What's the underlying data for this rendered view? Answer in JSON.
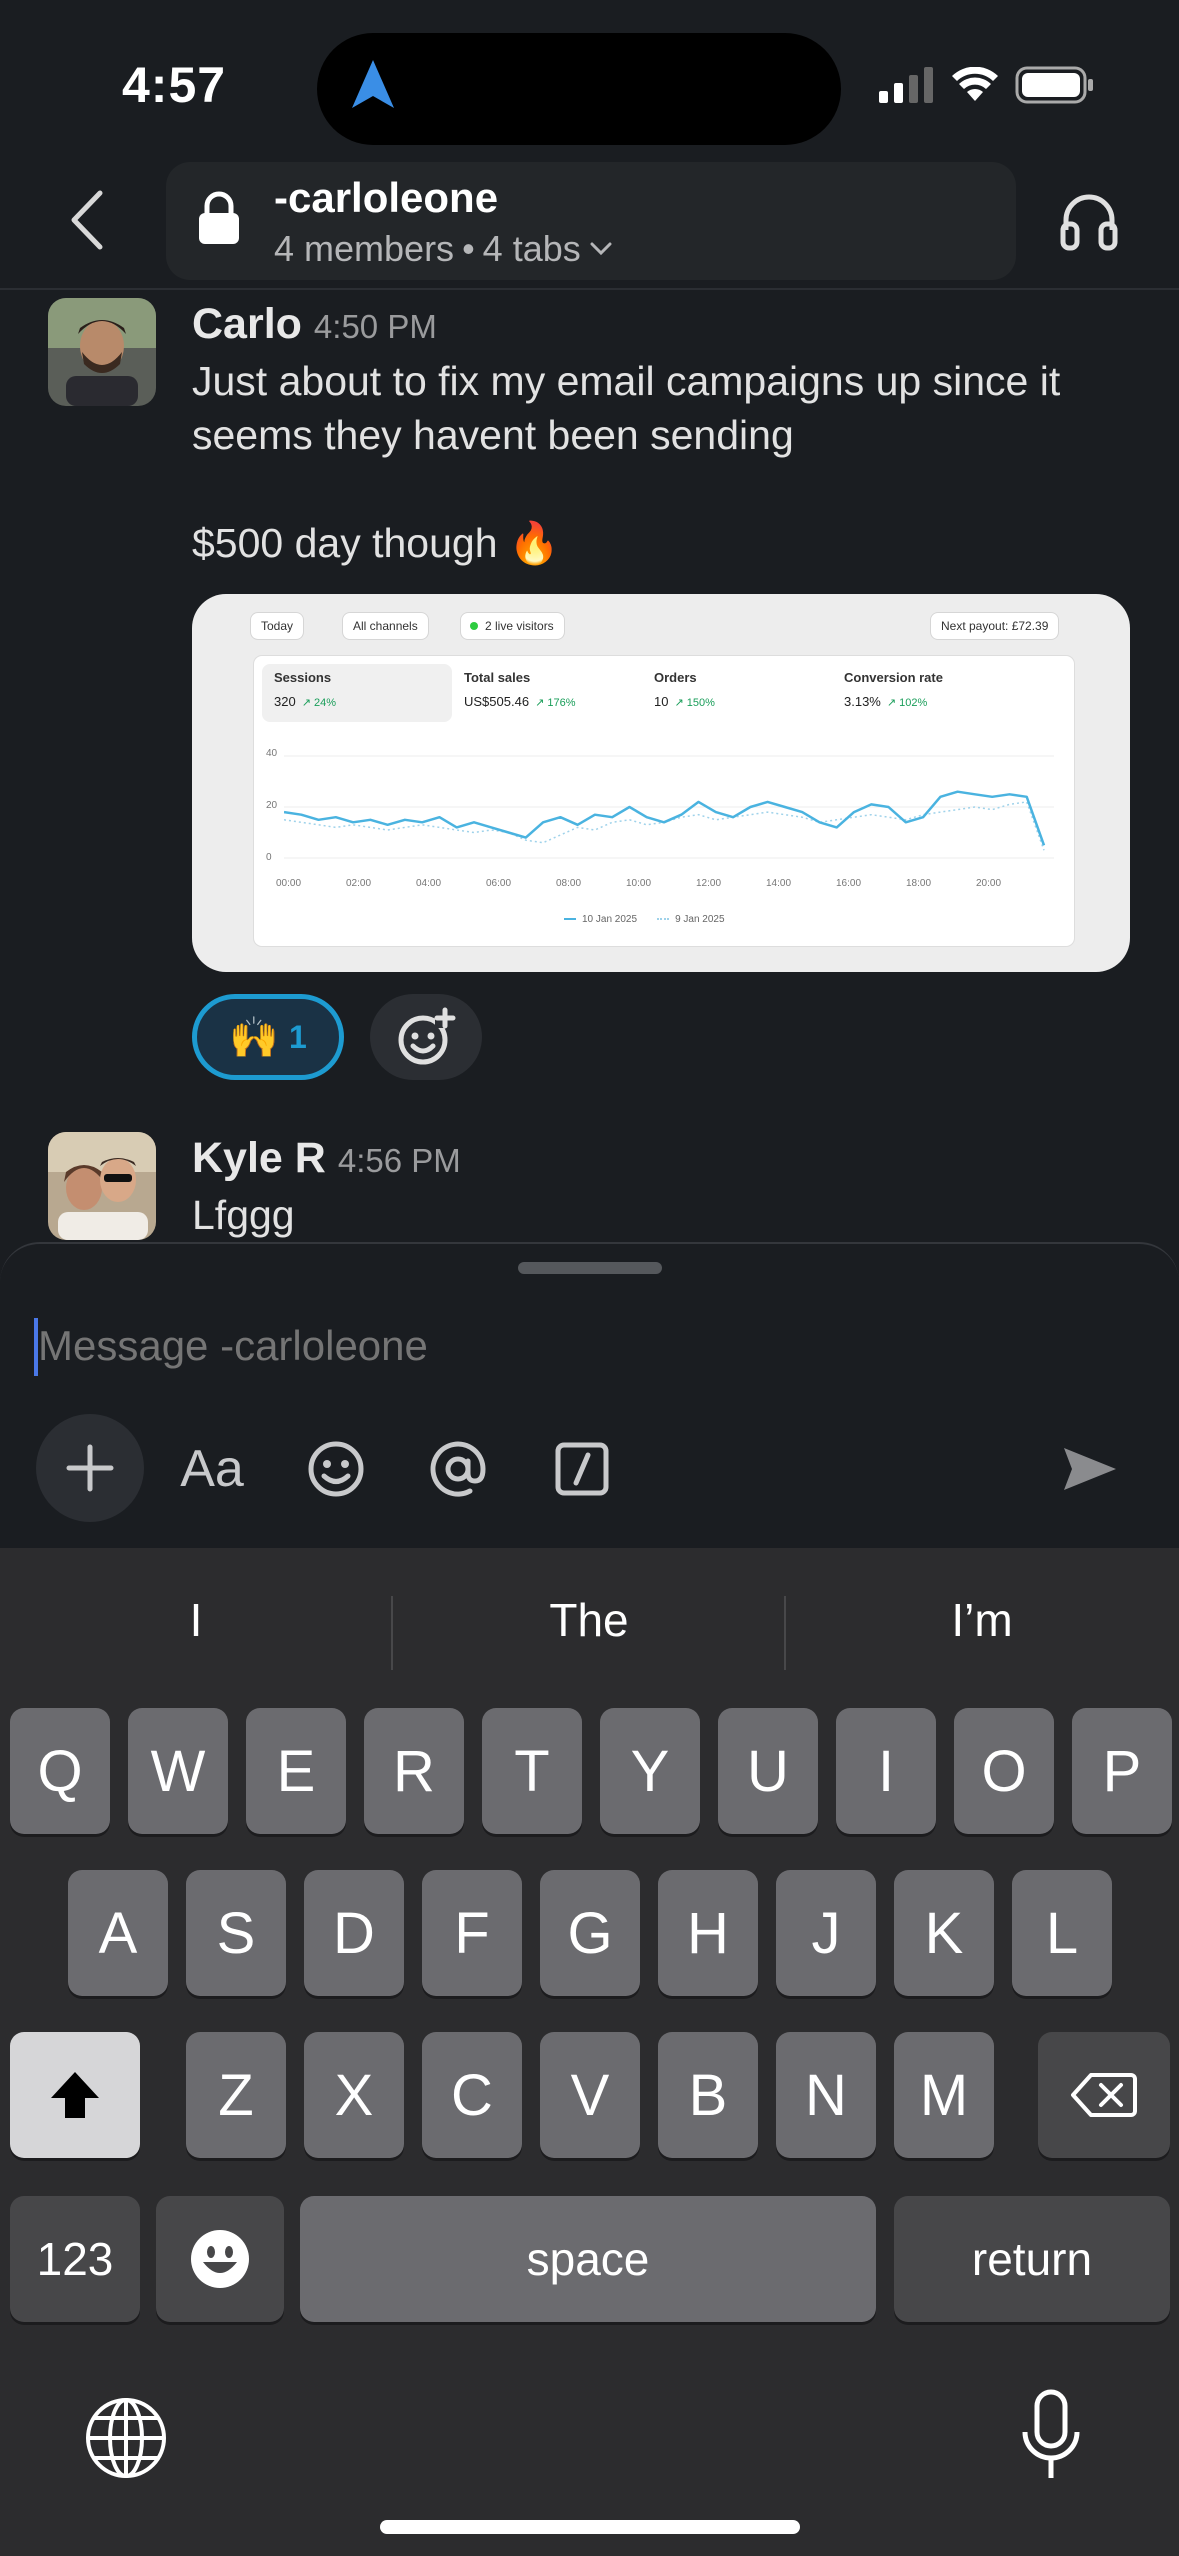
{
  "status_bar": {
    "time": "4:57",
    "icons": [
      "location-arrow-icon",
      "cellular-signal-icon",
      "wifi-icon",
      "battery-icon"
    ]
  },
  "header": {
    "channel_name": "-carloleone",
    "members": "4 members",
    "separator": "•",
    "tabs": "4 tabs"
  },
  "messages": [
    {
      "author": "Carlo",
      "time": "4:50 PM",
      "lines": [
        "Just about to fix my email campaigns up since it",
        "seems they havent been sending",
        "",
        "$500 day though 🔥"
      ],
      "attachment": {
        "chips": [
          "Today",
          "All channels",
          "2 live visitors",
          "Next payout: £72.39"
        ],
        "metrics": [
          {
            "label": "Sessions",
            "value": "320",
            "delta": "↗ 24%"
          },
          {
            "label": "Total sales",
            "value": "US$505.46",
            "delta": "↗ 176%"
          },
          {
            "label": "Orders",
            "value": "10",
            "delta": "↗ 150%"
          },
          {
            "label": "Conversion rate",
            "value": "3.13%",
            "delta": "↗ 102%"
          }
        ],
        "y_ticks": [
          "40",
          "20",
          "0"
        ],
        "x_ticks": [
          "00:00",
          "02:00",
          "04:00",
          "06:00",
          "08:00",
          "10:00",
          "12:00",
          "14:00",
          "16:00",
          "18:00",
          "20:00"
        ],
        "legend": [
          "10 Jan 2025",
          "9 Jan 2025"
        ],
        "series_current": [
          18,
          17,
          15,
          16,
          14,
          15,
          13,
          15,
          14,
          16,
          12,
          14,
          12,
          10,
          8,
          14,
          16,
          13,
          17,
          16,
          20,
          16,
          14,
          17,
          22,
          18,
          16,
          20,
          22,
          20,
          18,
          14,
          12,
          18,
          21,
          20,
          14,
          16,
          24,
          26,
          25,
          24,
          25,
          24,
          5
        ],
        "series_previous": [
          15,
          14,
          13,
          12,
          13,
          12,
          11,
          12,
          13,
          12,
          11,
          10,
          11,
          10,
          7,
          6,
          9,
          12,
          11,
          14,
          15,
          13,
          14,
          16,
          17,
          15,
          16,
          17,
          18,
          17,
          16,
          14,
          15,
          16,
          17,
          16,
          15,
          17,
          18,
          19,
          20,
          19,
          21,
          22,
          3
        ]
      },
      "reaction": {
        "emoji": "🙌",
        "count": "1"
      }
    },
    {
      "author": "Kyle R",
      "time": "4:56 PM",
      "lines": [
        "Lfggg"
      ]
    }
  ],
  "composer": {
    "placeholder": "Message -carloleone",
    "tools": [
      "plus-icon",
      "Aa",
      "emoji-icon",
      "mention-icon",
      "slash-command-icon",
      "send-icon"
    ],
    "format_label": "Aa"
  },
  "keyboard": {
    "suggestions": [
      "I",
      "The",
      "I’m"
    ],
    "row1": [
      "Q",
      "W",
      "E",
      "R",
      "T",
      "Y",
      "U",
      "I",
      "O",
      "P"
    ],
    "row2": [
      "A",
      "S",
      "D",
      "F",
      "G",
      "H",
      "J",
      "K",
      "L"
    ],
    "row3": [
      "Z",
      "X",
      "C",
      "V",
      "B",
      "N",
      "M"
    ],
    "numbers_label": "123",
    "space_label": "space",
    "return_label": "return"
  },
  "colors": {
    "background": "#1a1d21",
    "accent_blue": "#1d9bd1",
    "chart_line": "#4ab3e0"
  }
}
